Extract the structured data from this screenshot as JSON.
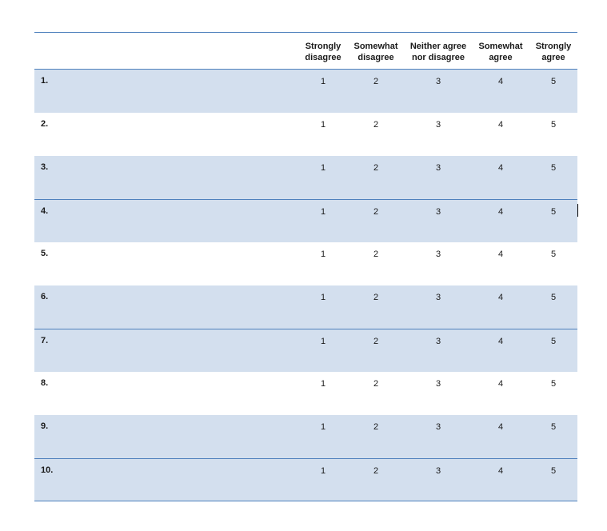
{
  "columns": [
    "Strongly disagree",
    "Somewhat disagree",
    "Neither agree nor disagree",
    "Somewhat agree",
    "Strongly agree"
  ],
  "scale": [
    "1",
    "2",
    "3",
    "4",
    "5"
  ],
  "rows": [
    "1.",
    "2.",
    "3.",
    "4.",
    "5.",
    "6.",
    "7.",
    "8.",
    "9.",
    "10."
  ]
}
